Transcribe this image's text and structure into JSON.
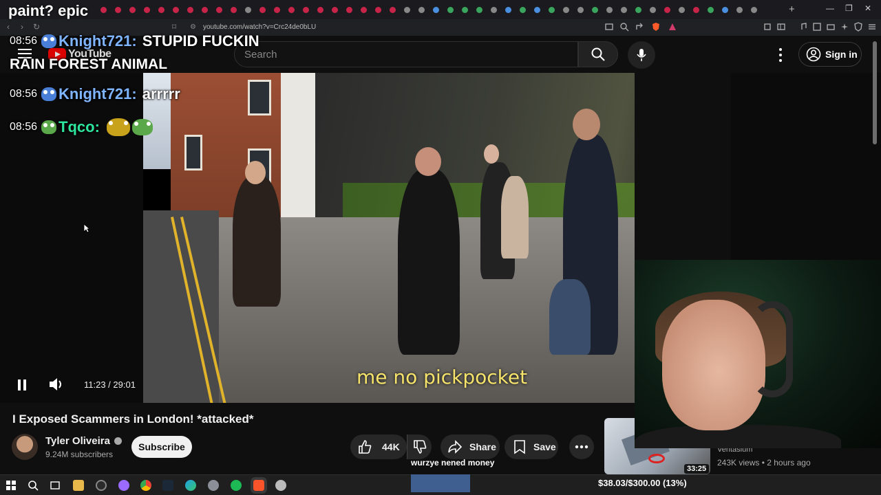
{
  "browser": {
    "url": "youtube.com/watch?v=Crc24de0bLU"
  },
  "youtube": {
    "logo_text": "YouTube",
    "search_placeholder": "Search",
    "signin_label": "Sign in"
  },
  "overlay": {
    "paint_text": "paint? epic",
    "chat": [
      {
        "time": "08:56",
        "user": "Knight721:",
        "message": "STUPID FUCKIN",
        "message_cont": "RAIN FOREST ANIMAL",
        "user_color": "#7fb4ff"
      },
      {
        "time": "08:56",
        "user": "Knight721:",
        "message": "arrrrr",
        "user_color": "#7fb4ff"
      },
      {
        "time": "08:56",
        "user": "Tqco:",
        "message": "",
        "user_color": "#2ee59d"
      }
    ]
  },
  "player": {
    "time_current": "11:23",
    "time_total": "29:01",
    "time_display": "11:23 / 29:01",
    "progress_fraction": 0.388,
    "caption": "me no pickpocket"
  },
  "video": {
    "title": "I Exposed Scammers in London! *attacked*",
    "channel": "Tyler Oliveira",
    "subscribers": "9.24M subscribers",
    "subscribe_label": "Subscribe",
    "likes": "44K",
    "share_label": "Share",
    "save_label": "Save"
  },
  "stream": {
    "donor_text": "wurzye nened money",
    "goal_text": "$38.03/$300.00 (13%)",
    "goal_fraction": 0.13
  },
  "recommendation": {
    "duration": "33:25",
    "channel": "Veritasium",
    "meta": "243K views • 2 hours ago"
  },
  "colors": {
    "accent_red": "#ff0033",
    "caption_yellow": "#f5e36b",
    "background": "#0f0f0f"
  }
}
